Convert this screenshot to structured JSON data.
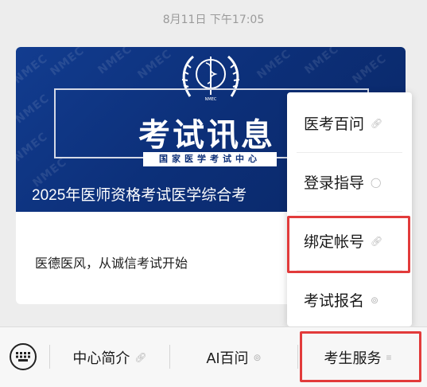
{
  "timestamp": "8月11日 下午17:05",
  "card": {
    "banner_title": "考试讯息",
    "banner_org": "国家医学考试中心",
    "banner_watermark": "NMEC",
    "banner_emblem_text": "NMEC",
    "banner_caption": "2025年医师资格考试医学综合考",
    "description": "医德医风，从诚信考试开始"
  },
  "popup_menu": {
    "items": [
      {
        "label": "医考百问",
        "icon": "link-icon"
      },
      {
        "label": "登录指导",
        "icon": "chat-bubble-icon"
      },
      {
        "label": "绑定帐号",
        "icon": "link-icon"
      },
      {
        "label": "考试报名",
        "icon": "mini-program-icon"
      }
    ]
  },
  "bottom_bar": {
    "keyboard_icon": "keyboard-icon",
    "menus": [
      {
        "label": "中心简介",
        "icon": "link-icon"
      },
      {
        "label": "AI百问",
        "icon": "mini-program-icon"
      },
      {
        "label": "考生服务",
        "icon": "menu-lines-icon"
      }
    ]
  },
  "colors": {
    "banner_blue": "#0c2f78",
    "highlight_red": "#e23b3b",
    "background": "#ededed"
  }
}
